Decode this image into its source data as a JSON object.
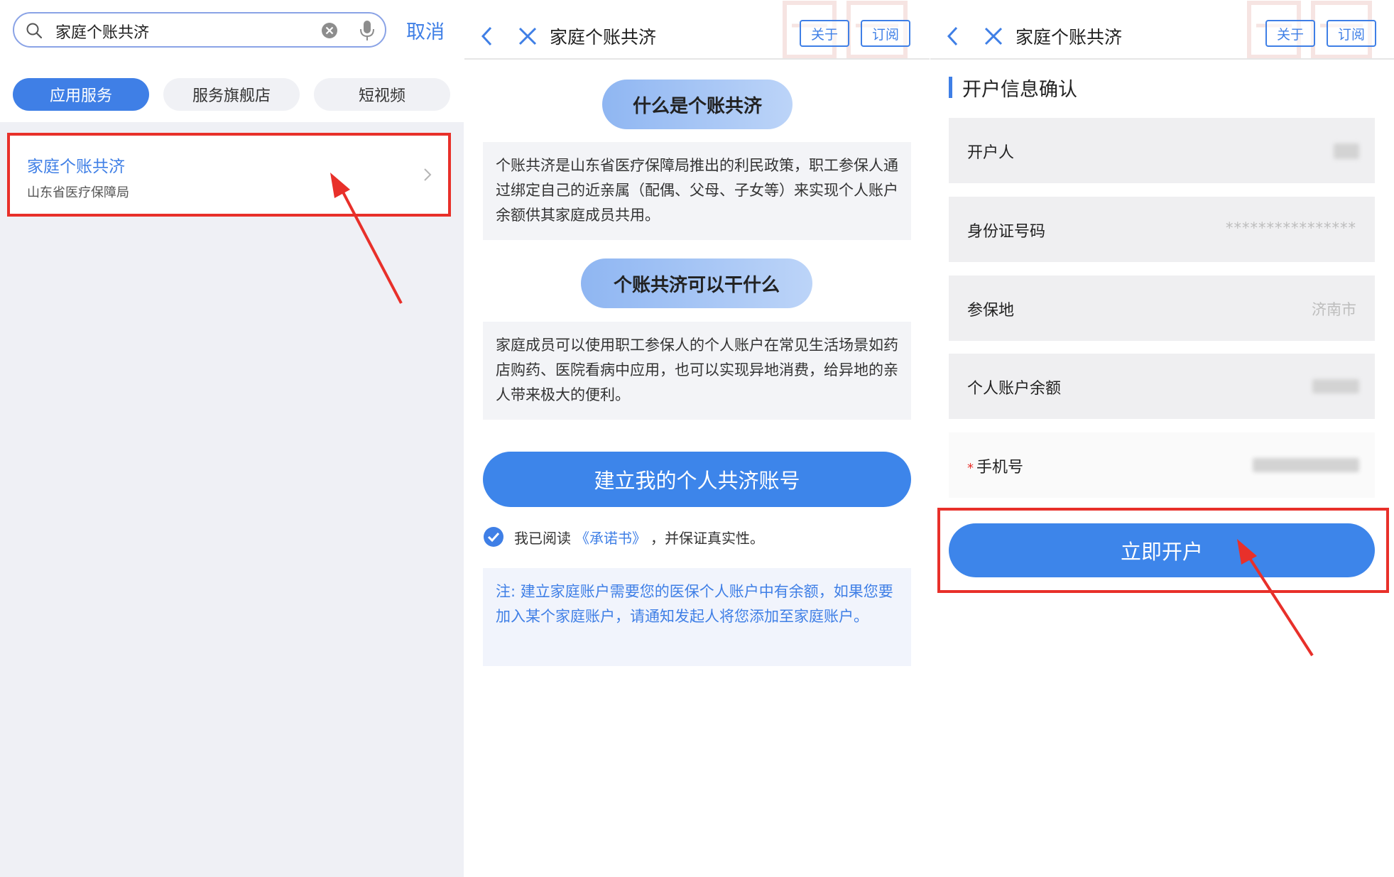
{
  "search_screen": {
    "search_query": "家庭个账共济",
    "cancel_label": "取消",
    "tabs": [
      {
        "label": "应用服务",
        "active": true
      },
      {
        "label": "服务旗舰店",
        "active": false
      },
      {
        "label": "短视频",
        "active": false
      }
    ],
    "result": {
      "title": "家庭个账共济",
      "subtitle": "山东省医疗保障局"
    }
  },
  "intro_screen": {
    "nav_title": "家庭个账共济",
    "about_label": "关于",
    "subscribe_label": "订阅",
    "section1_title": "什么是个账共济",
    "section1_text": "个账共济是山东省医疗保障局推出的利民政策，职工参保人通过绑定自己的近亲属（配偶、父母、子女等）来实现个人账户余额供其家庭成员共用。",
    "section2_title": "个账共济可以干什么",
    "section2_text": "家庭成员可以使用职工参保人的个人账户在常见生活场景如药店购药、医院看病中应用，也可以实现异地消费，给异地的亲人带来极大的便利。",
    "create_button": "建立我的个人共济账号",
    "agree_prefix": "我已阅读",
    "agree_link": "《承诺书》",
    "agree_suffix": "，并保证真实性。",
    "note_text": "注: 建立家庭账户需要您的医保个人账户中有余额，如果您要加入某个家庭账户，请通知发起人将您添加至家庭账户。"
  },
  "confirm_screen": {
    "nav_title": "家庭个账共济",
    "about_label": "关于",
    "subscribe_label": "订阅",
    "section_title": "开户信息确认",
    "fields": [
      {
        "label": "开户人",
        "value": ""
      },
      {
        "label": "身份证号码",
        "value": "****************"
      },
      {
        "label": "参保地",
        "value": "济南市"
      },
      {
        "label": "个人账户余额",
        "value": ""
      },
      {
        "label": "手机号",
        "value": "",
        "required_mark": "*"
      }
    ],
    "open_button": "立即开户"
  },
  "colors": {
    "accent": "#3f7fe6",
    "button": "#3d85ea",
    "highlight_red": "#e8302a",
    "page_bg": "#eff0f5"
  }
}
